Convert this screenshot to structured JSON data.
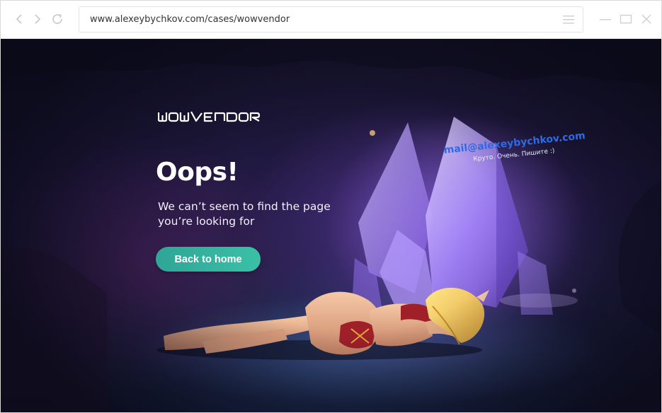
{
  "browser": {
    "url": "www.alexeybychkov.com/cases/wowvendor",
    "icons": {
      "back": "chevron-left-icon",
      "forward": "chevron-right-icon",
      "reload": "reload-icon",
      "menu": "hamburger-menu-icon",
      "minimize": "minimize-icon",
      "maximize": "maximize-icon",
      "close": "close-icon"
    }
  },
  "page": {
    "logo_text": "WOWVENDOR",
    "heading": "Oops!",
    "subtitle_line1": "We can’t seem to find the page",
    "subtitle_line2": "you’re looking for",
    "back_button": "Back to home",
    "colors": {
      "button_start": "#2fa596",
      "button_end": "#3bc0a7",
      "background": "#1e1a3c",
      "crystal": "#a88cff"
    }
  },
  "watermark": {
    "email": "mail@alexeybychkov.com",
    "note": "Круто. Очень. Пишите :)"
  }
}
